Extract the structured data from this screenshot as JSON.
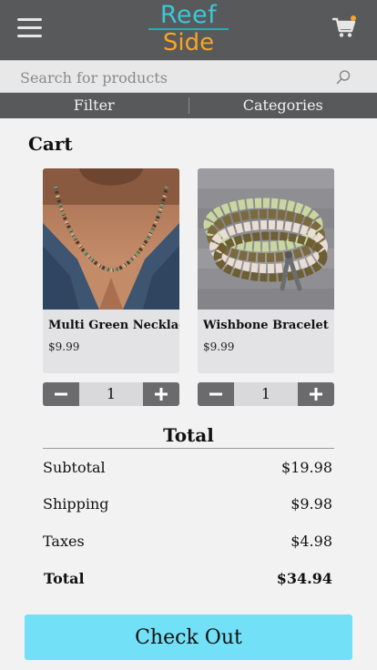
{
  "header": {
    "logo_line1": "Reef",
    "logo_line2": "Side",
    "cart_badge": true,
    "icons": [
      "hamburger-menu-icon",
      "shopping-cart-icon"
    ]
  },
  "search": {
    "placeholder": "Search for products",
    "value": ""
  },
  "filterbar": {
    "filter_label": "Filter",
    "categories_label": "Categories"
  },
  "cart": {
    "title": "Cart",
    "items": [
      {
        "name": "Multi Green Necklace",
        "price": "$9.99",
        "quantity": "1"
      },
      {
        "name": "Wishbone Bracelet",
        "price": "$9.99",
        "quantity": "1"
      }
    ]
  },
  "totals": {
    "heading": "Total",
    "subtotal_label": "Subtotal",
    "subtotal_value": "$19.98",
    "shipping_label": "Shipping",
    "shipping_value": "$9.98",
    "taxes_label": "Taxes",
    "taxes_value": "$4.98",
    "total_label": "Total",
    "total_value": "$34.94"
  },
  "checkout": {
    "label": "Check Out"
  },
  "colors": {
    "header_bg": "#58595b",
    "logo_teal": "#3cc7d6",
    "logo_orange": "#f5a623",
    "checkout_bg": "#72e0f7",
    "stepper_btn": "#6b6b6d"
  }
}
